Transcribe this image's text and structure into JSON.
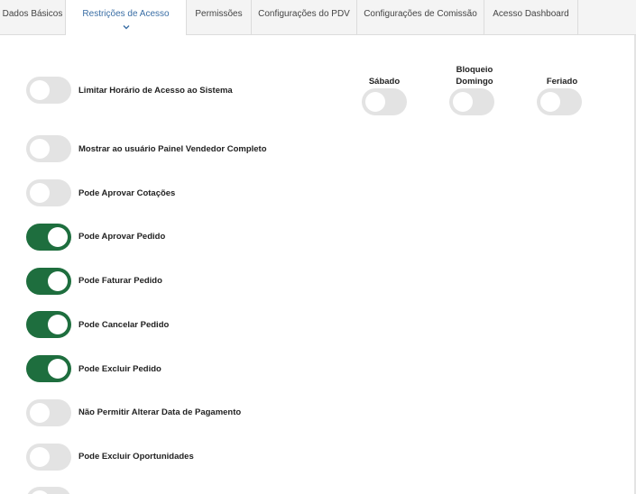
{
  "tabs": [
    {
      "label": "Dados Básicos",
      "active": false
    },
    {
      "label": "Restrições de Acesso",
      "active": true
    },
    {
      "label": "Permissões",
      "active": false
    },
    {
      "label": "Configurações do PDV",
      "active": false
    },
    {
      "label": "Configurações de Comissão",
      "active": false
    },
    {
      "label": "Acesso Dashboard",
      "active": false
    }
  ],
  "colors": {
    "accent": "#3a6ea5",
    "toggle_on": "#1e6e3e",
    "toggle_off": "#e3e3e3"
  },
  "icons": {
    "active_tab_indicator": "chevron-down-icon"
  },
  "schedule": {
    "saturday_label": "Sábado",
    "sunday_label_line1": "Bloqueio",
    "sunday_label_line2": "Domingo",
    "holiday_label": "Feriado",
    "saturday_on": false,
    "sunday_on": false,
    "holiday_on": false
  },
  "permissions": [
    {
      "label": "Limitar Horário de Acesso ao Sistema",
      "on": false
    },
    {
      "label": "Mostrar ao usuário Painel Vendedor Completo",
      "on": false
    },
    {
      "label": "Pode Aprovar Cotações",
      "on": false
    },
    {
      "label": "Pode Aprovar Pedido",
      "on": true
    },
    {
      "label": "Pode Faturar Pedido",
      "on": true
    },
    {
      "label": "Pode Cancelar Pedido",
      "on": true
    },
    {
      "label": "Pode Excluir Pedido",
      "on": true
    },
    {
      "label": "Não Permitir Alterar Data de Pagamento",
      "on": false
    },
    {
      "label": "Pode Excluir Oportunidades",
      "on": false
    },
    {
      "label": "",
      "on": false
    }
  ]
}
